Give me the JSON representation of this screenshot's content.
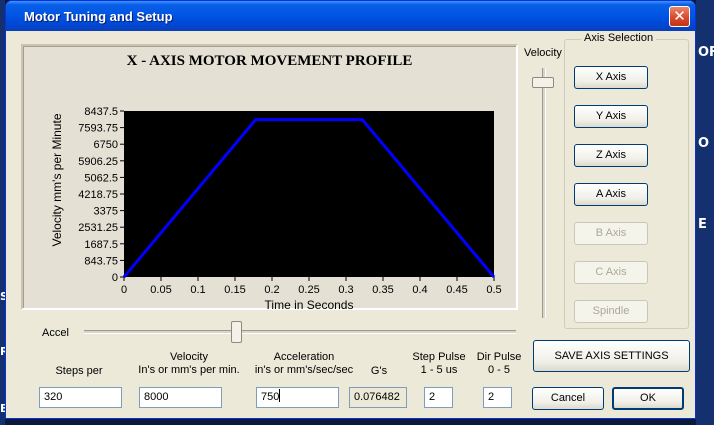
{
  "window": {
    "title": "Motor Tuning and Setup",
    "close_glyph": "✕"
  },
  "background": {
    "fragments": [
      "OF",
      "O",
      "E",
      "S",
      "R",
      "BI"
    ]
  },
  "chart_data": {
    "type": "line",
    "title": "X - AXIS MOTOR MOVEMENT PROFILE",
    "xlabel": "Time in Seconds",
    "ylabel": "Velocity mm's per Minute",
    "x_ticks": [
      "0",
      "0.05",
      "0.1",
      "0.15",
      "0.2",
      "0.25",
      "0.3",
      "0.35",
      "0.4",
      "0.45",
      "0.5"
    ],
    "y_ticks": [
      "0",
      "843.75",
      "1687.5",
      "2531.25",
      "3375",
      "4218.75",
      "5062.5",
      "5906.25",
      "6750",
      "7593.75",
      "8437.5"
    ],
    "xlim": [
      0,
      0.5
    ],
    "ylim": [
      0,
      8437.5
    ],
    "grid": false,
    "plot_background": "#000000",
    "series": [
      {
        "color": "#0000ff",
        "x": [
          0,
          0.178,
          0.322,
          0.5
        ],
        "y": [
          0,
          8000,
          8000,
          0
        ]
      }
    ]
  },
  "velocity_slider": {
    "label": "Velocity"
  },
  "axis_selection": {
    "legend": "Axis Selection",
    "buttons": [
      {
        "label": "X Axis",
        "enabled": true
      },
      {
        "label": "Y Axis",
        "enabled": true
      },
      {
        "label": "Z Axis",
        "enabled": true
      },
      {
        "label": "A Axis",
        "enabled": true
      },
      {
        "label": "B Axis",
        "enabled": false
      },
      {
        "label": "C Axis",
        "enabled": false
      },
      {
        "label": "Spindle",
        "enabled": false
      }
    ]
  },
  "accel_slider": {
    "label": "Accel"
  },
  "fields": {
    "steps_per": {
      "label": "Steps per",
      "value": "320"
    },
    "velocity": {
      "label1": "Velocity",
      "label2": "In's or mm's per min.",
      "value": "8000"
    },
    "acceleration": {
      "label1": "Acceleration",
      "label2": "in's or mm's/sec/sec",
      "value": "750"
    },
    "gs": {
      "label": "G's",
      "value": "0.076482"
    },
    "step_pulse": {
      "label1": "Step Pulse",
      "label2": "1 - 5 us",
      "value": "2"
    },
    "dir_pulse": {
      "label1": "Dir Pulse",
      "label2": "0 - 5",
      "value": "2"
    }
  },
  "actions": {
    "save": "SAVE AXIS SETTINGS",
    "cancel": "Cancel",
    "ok": "OK"
  }
}
